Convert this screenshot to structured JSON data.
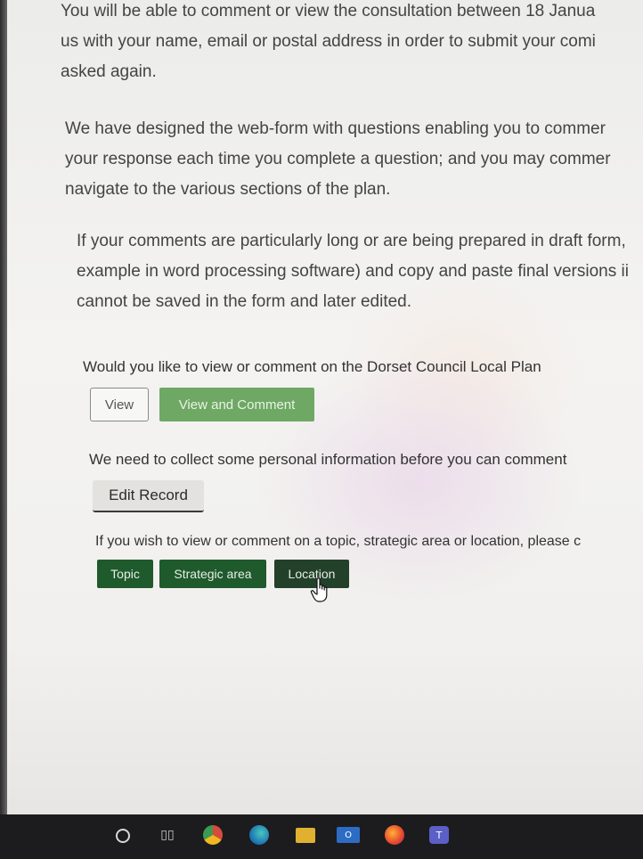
{
  "intro": {
    "paragraph1": [
      "You will be able to comment or view the consultation between 18 Janua",
      "us with your name, email or postal address in order to submit your comi",
      "asked again."
    ],
    "paragraph2": [
      "We have designed the web-form with questions enabling you to commer",
      "your response each time you complete a question; and you may commer",
      "navigate to the various sections of the plan."
    ],
    "paragraph3": [
      "If your comments are particularly long or are being prepared in draft form,",
      "example in word processing software) and copy and paste final versions ii",
      "cannot be saved in the form and later edited."
    ]
  },
  "plan_section": {
    "question": "Would you like to view or comment on the Dorset Council Local Plan",
    "view_label": "View",
    "view_comment_label": "View and Comment"
  },
  "personal_section": {
    "text": "We need to collect some personal information before you can comment",
    "edit_label": "Edit Record"
  },
  "topic_section": {
    "text": "If you wish to view or comment on a topic, strategic area or location, please c",
    "topic_label": "Topic",
    "strategic_label": "Strategic area",
    "location_label": "Location"
  },
  "taskbar": {
    "icons": [
      "search-icon",
      "task-view-icon",
      "chrome-icon",
      "edge-icon",
      "file-explorer-icon",
      "outlook-icon",
      "firefox-icon",
      "teams-icon"
    ],
    "outlook_glyph": "O",
    "teams_glyph": "T",
    "taskview_glyph": "▯▯"
  },
  "colors": {
    "view_comment_green": "#6fa865",
    "dark_green": "#1f5a2c",
    "location_green": "#23402a"
  }
}
